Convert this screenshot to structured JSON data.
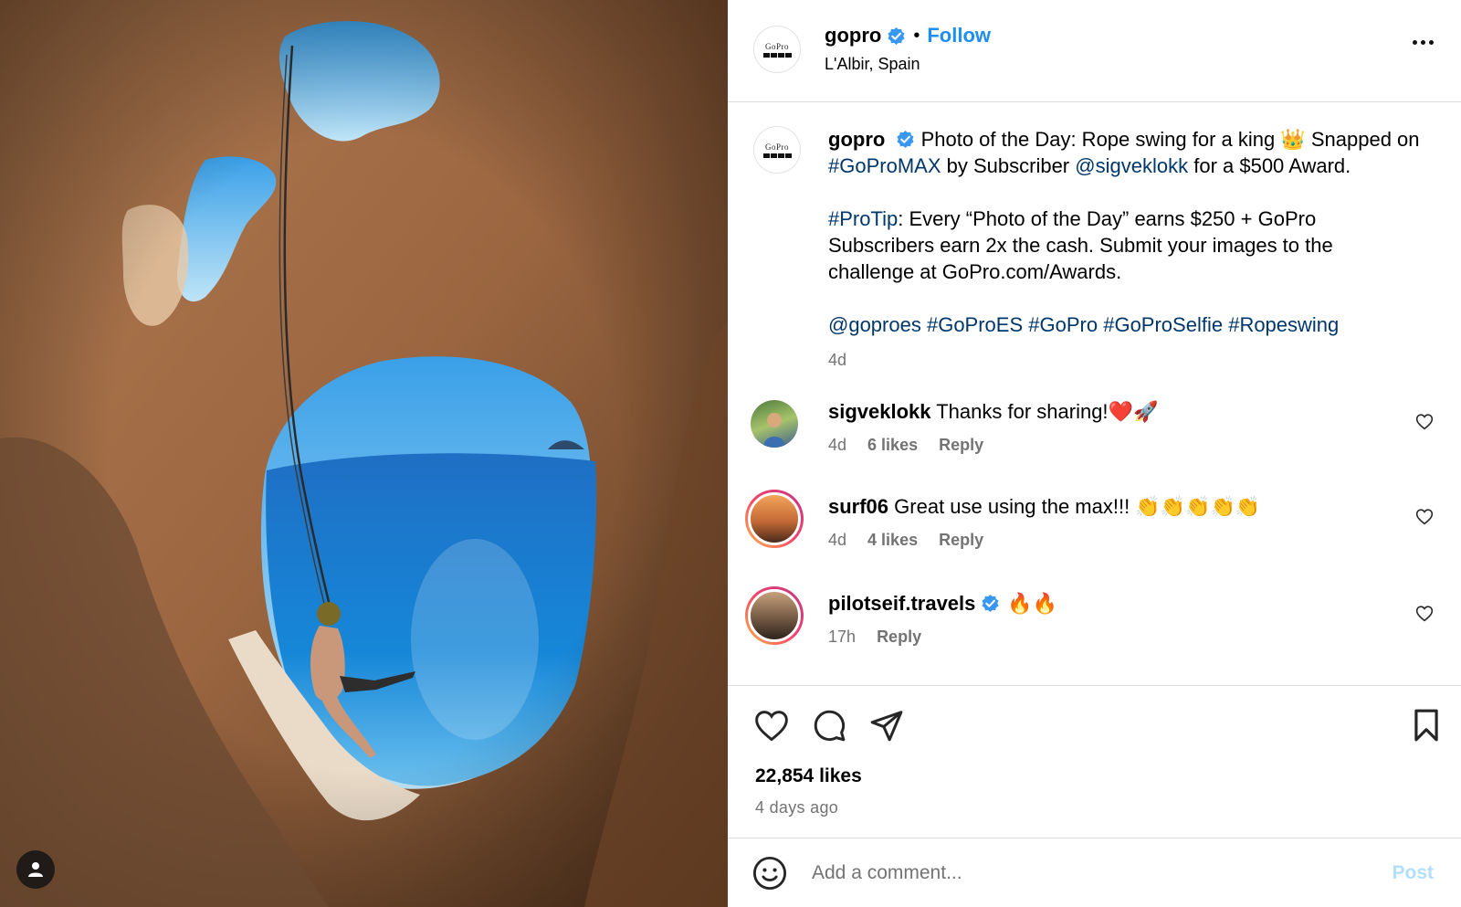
{
  "post": {
    "username": "gopro",
    "follow_label": "Follow",
    "separator": "•",
    "location": "L'Albir, Spain",
    "avatar_logo_text": "GoPro"
  },
  "caption": {
    "username": "gopro",
    "text_1": "Photo of the Day: Rope swing for a king 👑 Snapped on",
    "hashtag_max": "#GoProMAX",
    "text_2": "by Subscriber",
    "mention_author": "@sigveklokk",
    "text_3": "for a $500 Award.",
    "protip_tag": "#ProTip",
    "protip_text": ": Every “Photo of the Day” earns $250 + GoPro Subscribers earn 2x the cash. Submit your images to the challenge at GoPro.com/Awards.",
    "tags": [
      "@goproes",
      "#GoProES",
      "#GoPro",
      "#GoProSelfie",
      "#Ropeswing"
    ],
    "time": "4d"
  },
  "comments": [
    {
      "username": "sigveklokk",
      "text": "Thanks for sharing!❤️🚀",
      "time": "4d",
      "likes": "6 likes",
      "reply": "Reply"
    },
    {
      "username": "surf06",
      "text": "Great use using the max!!! 👏👏👏👏👏",
      "time": "4d",
      "likes": "4 likes",
      "reply": "Reply"
    },
    {
      "username": "pilotseif.travels",
      "text": "🔥🔥",
      "time": "17h",
      "reply": "Reply"
    }
  ],
  "stats": {
    "likes": "22,854 likes",
    "posted": "4 days ago"
  },
  "composer": {
    "placeholder": "Add a comment...",
    "post_label": "Post"
  },
  "colors": {
    "link": "#00376b",
    "follow": "#1d8ff2",
    "verified": "#3897f0",
    "muted": "#737373",
    "post_disabled": "#b2dffc"
  }
}
